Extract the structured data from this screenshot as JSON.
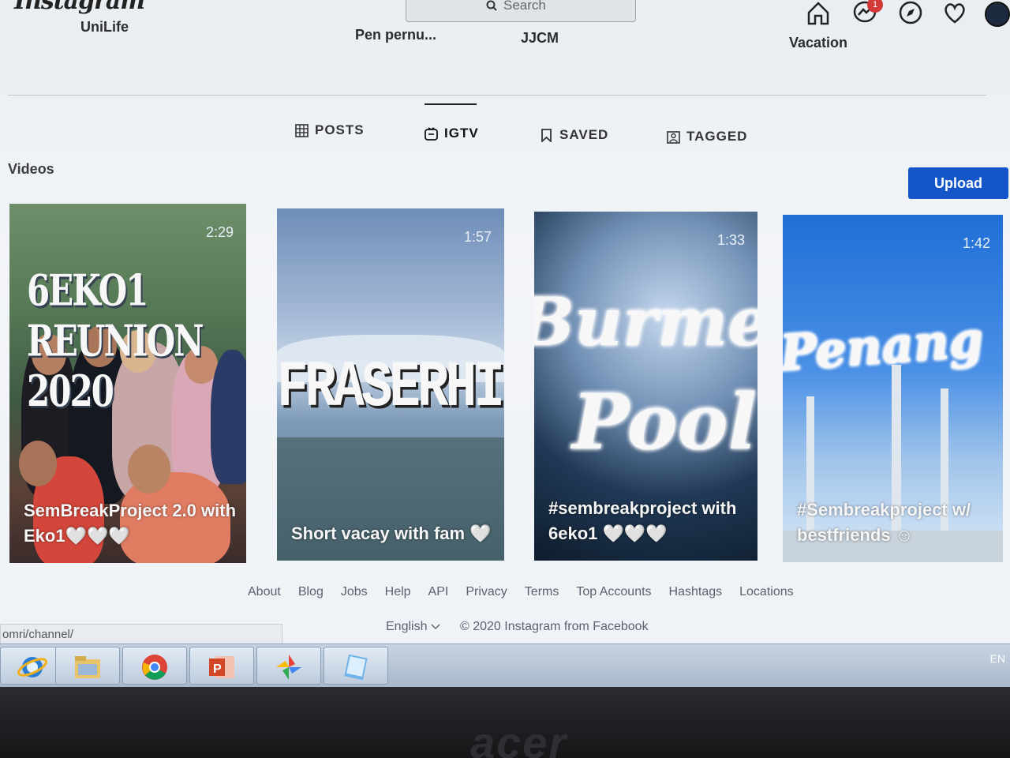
{
  "app": {
    "logo_text": "Instagram"
  },
  "search": {
    "placeholder": "Search"
  },
  "nav": {
    "icons": [
      "home-icon",
      "messenger-icon",
      "explore-icon",
      "activity-heart-icon",
      "profile-avatar"
    ],
    "notification_count": "1"
  },
  "highlights": [
    "UniLife",
    "Pen pernu...",
    "JJCM",
    "Vacation"
  ],
  "tabs": [
    {
      "label": "POSTS",
      "icon": "grid-icon"
    },
    {
      "label": "IGTV",
      "icon": "igtv-icon",
      "active": true
    },
    {
      "label": "SAVED",
      "icon": "bookmark-icon"
    },
    {
      "label": "TAGGED",
      "icon": "tagged-icon"
    }
  ],
  "section": {
    "title": "Videos",
    "upload_label": "Upload"
  },
  "videos": [
    {
      "overlay": "6EKO1 REUNION 2020",
      "duration": "2:29",
      "caption": "SemBreakProject 2.0 with Eko1🤍🤍🤍"
    },
    {
      "overlay": "FRASERHIL",
      "duration": "1:57",
      "caption": "Short vacay with fam 🤍"
    },
    {
      "overlay_top": "Burmes",
      "overlay_bottom": "Pool",
      "duration": "1:33",
      "caption": "#sembreakproject with 6eko1 🤍🤍🤍"
    },
    {
      "overlay": "Penang",
      "duration": "1:42",
      "caption": "#Sembreakproject w/ bestfriends ☺"
    }
  ],
  "footer": {
    "links": [
      "About",
      "Blog",
      "Jobs",
      "Help",
      "API",
      "Privacy",
      "Terms",
      "Top Accounts",
      "Hashtags",
      "Locations"
    ],
    "language": "English",
    "copyright": "© 2020 Instagram from Facebook"
  },
  "status_url": "omri/channel/",
  "taskbar": {
    "apps": [
      "internet-explorer-icon",
      "file-explorer-icon",
      "chrome-icon",
      "powerpoint-icon",
      "photos-icon",
      "notes-icon"
    ],
    "language_indicator": "EN"
  },
  "monitor": {
    "brand": "acer"
  },
  "colors": {
    "accent": "#1456c9",
    "background": "#eef2f6",
    "badge": "#d23a3a"
  }
}
